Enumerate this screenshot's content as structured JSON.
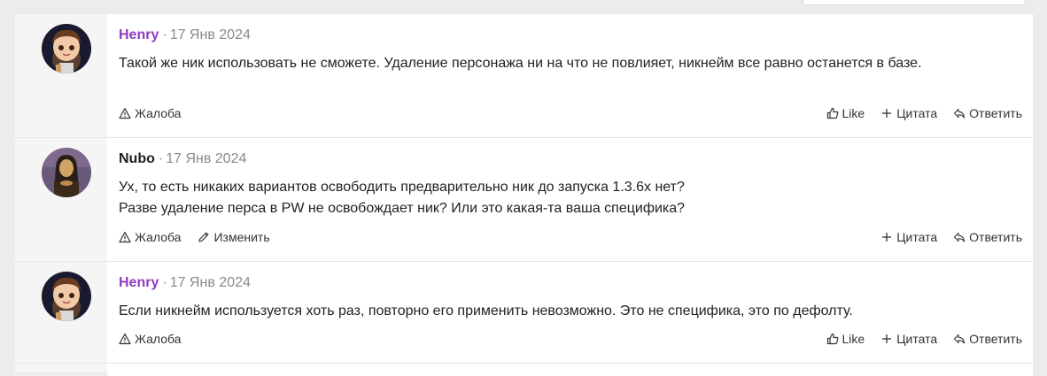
{
  "posts": [
    {
      "author": "Henry",
      "date": "17 Янв 2024",
      "text": "Такой же ник использовать не сможете. Удаление персонажа ни на что не повлияет, никнейм все равно останется в базе.",
      "actions_left": [
        "Жалоба"
      ],
      "actions_right": [
        "Like",
        "Цитата",
        "Ответить"
      ]
    },
    {
      "author": "Nubo",
      "date": "17 Янв 2024",
      "text_line1": "Ух, то есть никаких вариантов освободить предварительно ник до запуска 1.3.6х нет?",
      "text_line2": "Разве удаление перса в PW не освобождает ник? Или это какая-та ваша специфика?",
      "actions_left": [
        "Жалоба",
        "Изменить"
      ],
      "actions_right": [
        "Цитата",
        "Ответить"
      ]
    },
    {
      "author": "Henry",
      "date": "17 Янв 2024",
      "text": "Если никнейм используется хоть раз, повторно его применить невозможно. Это не специфика, это по дефолту.",
      "actions_left": [
        "Жалоба"
      ],
      "actions_right": [
        "Like",
        "Цитата",
        "Ответить"
      ]
    }
  ],
  "icons": {
    "report": "warning-triangle-icon",
    "edit": "pencil-icon",
    "like": "thumbs-up-icon",
    "quote": "plus-icon",
    "reply": "reply-arrow-icon"
  },
  "colors": {
    "author_henry": "#8f3bbf",
    "author_nubo": "#222222",
    "meta": "#8a8a8a",
    "rail": "#f5f5f5",
    "page_bg": "#ececec"
  }
}
